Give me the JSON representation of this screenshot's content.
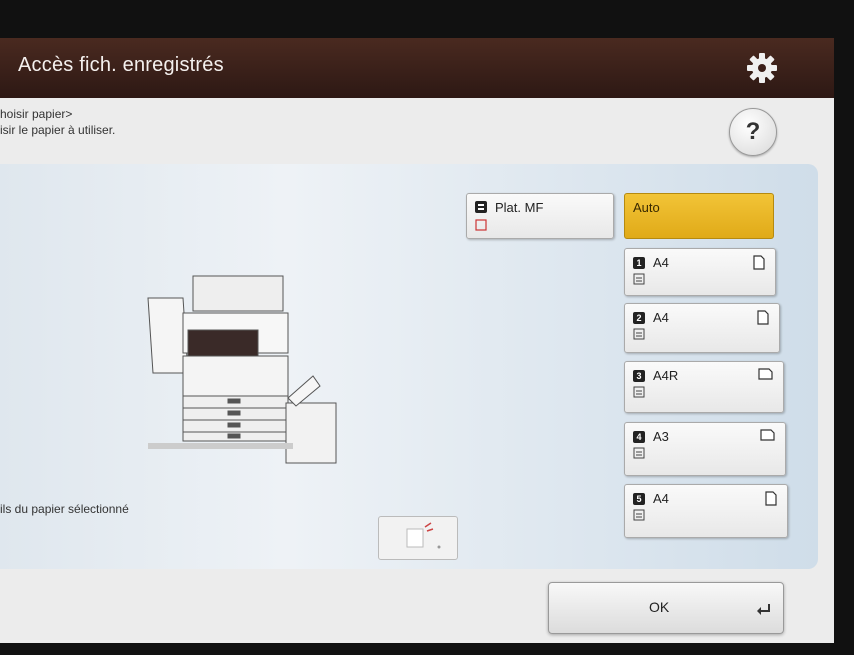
{
  "window": {
    "title": "Accès fich. enregistrés"
  },
  "icons": {
    "settings": "gear-icon",
    "help": "question-mark-icon",
    "enter": "enter-arrow-icon"
  },
  "instructions": {
    "line1": "hoisir papier>",
    "line2": "isir le papier à utiliser."
  },
  "help": {
    "label": "?"
  },
  "details": {
    "label": "ils du papier sélectionné"
  },
  "paper_sources": {
    "mf": {
      "label": "Plat. MF"
    },
    "auto": {
      "label": "Auto",
      "selected": true,
      "color": "#e9b62a"
    },
    "trays": [
      {
        "number": "1",
        "size": "A4"
      },
      {
        "number": "2",
        "size": "A4"
      },
      {
        "number": "3",
        "size": "A4R"
      },
      {
        "number": "4",
        "size": "A3"
      },
      {
        "number": "5",
        "size": "A4"
      }
    ]
  },
  "actions": {
    "ok": "OK"
  }
}
